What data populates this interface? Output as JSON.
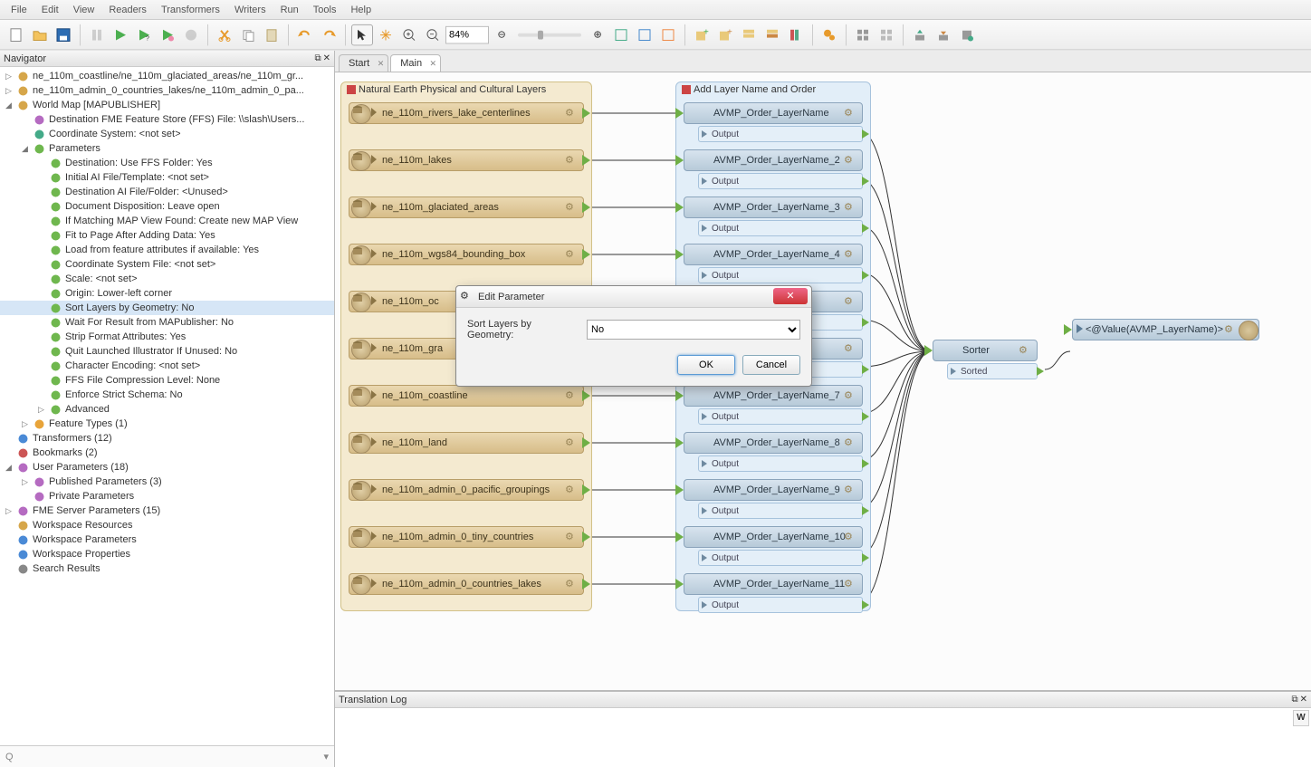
{
  "menu": [
    "File",
    "Edit",
    "View",
    "Readers",
    "Transformers",
    "Writers",
    "Run",
    "Tools",
    "Help"
  ],
  "toolbar": {
    "zoom": "84%"
  },
  "navigator": {
    "title": "Navigator",
    "tree": [
      {
        "d": 0,
        "e": "▷",
        "icon": "reader-icon",
        "t": "ne_110m_coastline/ne_110m_glaciated_areas/ne_110m_gr..."
      },
      {
        "d": 0,
        "e": "▷",
        "icon": "reader-icon",
        "t": "ne_110m_admin_0_countries_lakes/ne_110m_admin_0_pa..."
      },
      {
        "d": 0,
        "e": "◢",
        "icon": "writer-icon",
        "t": "World Map [MAPUBLISHER]"
      },
      {
        "d": 1,
        "e": "",
        "icon": "gear-purple-icon",
        "t": "Destination FME Feature Store (FFS) File: \\\\slash\\Users..."
      },
      {
        "d": 1,
        "e": "",
        "icon": "globe-icon",
        "t": "Coordinate System: <not set>"
      },
      {
        "d": 1,
        "e": "◢",
        "icon": "gear-green-icon",
        "t": "Parameters"
      },
      {
        "d": 2,
        "e": "",
        "icon": "gear-green-icon",
        "t": "Destination: Use FFS Folder: Yes"
      },
      {
        "d": 2,
        "e": "",
        "icon": "gear-green-icon",
        "t": "Initial AI File/Template: <not set>"
      },
      {
        "d": 2,
        "e": "",
        "icon": "gear-green-icon",
        "t": "Destination AI File/Folder: <Unused>"
      },
      {
        "d": 2,
        "e": "",
        "icon": "gear-green-icon",
        "t": "Document Disposition: Leave open"
      },
      {
        "d": 2,
        "e": "",
        "icon": "gear-green-icon",
        "t": "If Matching MAP View Found: Create new MAP View"
      },
      {
        "d": 2,
        "e": "",
        "icon": "gear-green-icon",
        "t": "Fit to Page After Adding Data: Yes"
      },
      {
        "d": 2,
        "e": "",
        "icon": "gear-green-icon",
        "t": "Load from feature attributes if available: Yes"
      },
      {
        "d": 2,
        "e": "",
        "icon": "gear-green-icon",
        "t": "Coordinate System File: <not set>"
      },
      {
        "d": 2,
        "e": "",
        "icon": "gear-green-icon",
        "t": "Scale: <not set>"
      },
      {
        "d": 2,
        "e": "",
        "icon": "gear-green-icon",
        "t": "Origin: Lower-left corner"
      },
      {
        "d": 2,
        "e": "",
        "icon": "gear-green-icon",
        "t": "Sort Layers by Geometry: No",
        "sel": true
      },
      {
        "d": 2,
        "e": "",
        "icon": "gear-green-icon",
        "t": "Wait For Result from MAPublisher: No"
      },
      {
        "d": 2,
        "e": "",
        "icon": "gear-green-icon",
        "t": "Strip Format Attributes: Yes"
      },
      {
        "d": 2,
        "e": "",
        "icon": "gear-green-icon",
        "t": "Quit Launched Illustrator If Unused: No"
      },
      {
        "d": 2,
        "e": "",
        "icon": "gear-green-icon",
        "t": "Character Encoding: <not set>"
      },
      {
        "d": 2,
        "e": "",
        "icon": "gear-green-icon",
        "t": "FFS File Compression Level: None"
      },
      {
        "d": 2,
        "e": "",
        "icon": "gear-green-icon",
        "t": "Enforce Strict Schema: No"
      },
      {
        "d": 2,
        "e": "▷",
        "icon": "gear-green-icon",
        "t": "Advanced"
      },
      {
        "d": 1,
        "e": "▷",
        "icon": "feature-icon",
        "t": "Feature Types (1)"
      },
      {
        "d": 0,
        "e": "",
        "icon": "transformer-icon",
        "t": "Transformers (12)"
      },
      {
        "d": 0,
        "e": "",
        "icon": "bookmark-icon",
        "t": "Bookmarks (2)"
      },
      {
        "d": 0,
        "e": "◢",
        "icon": "gear-purple-icon",
        "t": "User Parameters (18)"
      },
      {
        "d": 1,
        "e": "▷",
        "icon": "gear-purple-icon",
        "t": "Published Parameters (3)"
      },
      {
        "d": 1,
        "e": "",
        "icon": "gear-purple-icon",
        "t": "Private Parameters"
      },
      {
        "d": 0,
        "e": "▷",
        "icon": "gear-purple-icon",
        "t": "FME Server Parameters (15)"
      },
      {
        "d": 0,
        "e": "",
        "icon": "folder-icon",
        "t": "Workspace Resources"
      },
      {
        "d": 0,
        "e": "",
        "icon": "gear-blue-icon",
        "t": "Workspace Parameters"
      },
      {
        "d": 0,
        "e": "",
        "icon": "prop-icon",
        "t": "Workspace Properties"
      },
      {
        "d": 0,
        "e": "",
        "icon": "search-icon",
        "t": "Search Results"
      }
    ],
    "search_placeholder": "Q"
  },
  "tabs": [
    {
      "label": "Start",
      "active": false
    },
    {
      "label": "Main",
      "active": true
    }
  ],
  "groups": {
    "physical": {
      "title": "Natural Earth Physical and Cultural Layers"
    },
    "addlayer": {
      "title": "Add Layer Name and Order"
    }
  },
  "readers": [
    "ne_110m_rivers_lake_centerlines",
    "ne_110m_lakes",
    "ne_110m_glaciated_areas",
    "ne_110m_wgs84_bounding_box",
    "ne_110m_oc",
    "ne_110m_gra",
    "ne_110m_coastline",
    "ne_110m_land",
    "ne_110m_admin_0_pacific_groupings",
    "ne_110m_admin_0_tiny_countries",
    "ne_110m_admin_0_countries_lakes"
  ],
  "transformers": [
    "AVMP_Order_LayerName",
    "AVMP_Order_LayerName_2",
    "AVMP_Order_LayerName_3",
    "AVMP_Order_LayerName_4",
    "",
    "",
    "AVMP_Order_LayerName_7",
    "AVMP_Order_LayerName_8",
    "AVMP_Order_LayerName_9",
    "AVMP_Order_LayerName_10",
    "AVMP_Order_LayerName_11"
  ],
  "output_label": "Output",
  "sorter": {
    "name": "Sorter",
    "port": "Sorted"
  },
  "writer": {
    "label": "<@Value(AVMP_LayerName)>"
  },
  "translation_log": {
    "title": "Translation Log"
  },
  "dialog": {
    "title": "Edit Parameter",
    "label": "Sort Layers by Geometry:",
    "value": "No",
    "ok": "OK",
    "cancel": "Cancel"
  }
}
